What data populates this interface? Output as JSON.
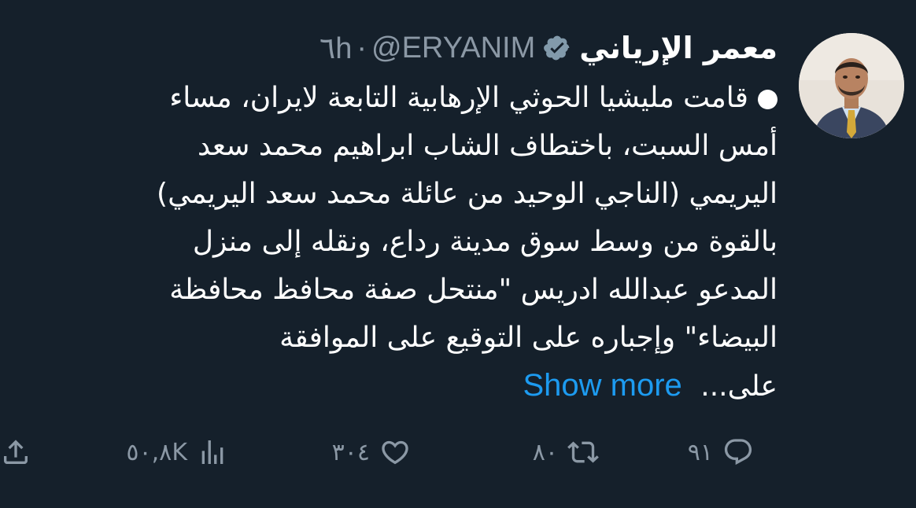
{
  "tweet": {
    "display_name": "معمر الإرياني",
    "handle": "@ERYANIM",
    "separator": "·",
    "time": "٦h",
    "body_lines": [
      "قامت مليشيا الحوثي الإرهابية التابعة لايران، مساء",
      "أمس السبت، باختطاف الشاب ابراهيم محمد سعد",
      "اليريمي (الناجي الوحيد من عائلة محمد سعد اليريمي)",
      "بالقوة من وسط سوق مدينة رداع، ونقله إلى منزل",
      "المدعو عبدالله ادريس \"منتحل صفة محافظ محافظة",
      "البيضاء\" وإجباره على التوقيع على الموافقة",
      "على..."
    ],
    "show_more": "Show more"
  },
  "actions": {
    "replies": "٩١",
    "retweets": "٨٠",
    "likes": "٣٠٤",
    "views": "٥٠,٨K"
  },
  "icons": {
    "verified": "verified-badge-icon",
    "reply": "reply-icon",
    "retweet": "retweet-icon",
    "like": "heart-icon",
    "views": "views-chart-icon",
    "share": "share-icon"
  },
  "colors": {
    "background": "#15202b",
    "text": "#ffffff",
    "secondary": "#8b98a5",
    "link": "#1d9bf0"
  }
}
